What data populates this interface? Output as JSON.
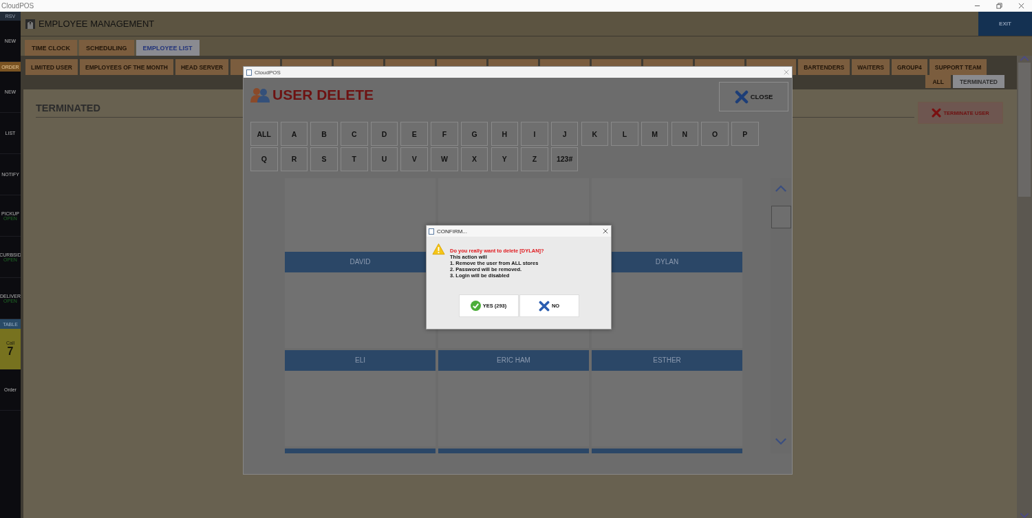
{
  "window": {
    "title": "CloudPOS"
  },
  "sidebar": [
    {
      "kind": "header",
      "label": "RSV"
    },
    {
      "kind": "item",
      "label": "NEW"
    },
    {
      "kind": "accent",
      "label": "ORDER"
    },
    {
      "kind": "item",
      "label": "NEW"
    },
    {
      "kind": "item",
      "label": "LIST"
    },
    {
      "kind": "item",
      "label": "NOTIFY"
    },
    {
      "kind": "status",
      "label": "PICKUP",
      "status": "OPEN"
    },
    {
      "kind": "status",
      "label": "CURBSID",
      "status": "OPEN"
    },
    {
      "kind": "status",
      "label": "DELIVER",
      "status": "OPEN"
    },
    {
      "kind": "section",
      "label": "TABLE"
    },
    {
      "kind": "highlight",
      "label": "Call",
      "value": "7"
    },
    {
      "kind": "item",
      "label": "Order"
    }
  ],
  "header": {
    "title": "EMPLOYEE MANAGEMENT",
    "exit": "EXIT"
  },
  "tabs": [
    {
      "label": "TIME CLOCK",
      "selected": false
    },
    {
      "label": "SCHEDULING",
      "selected": false
    },
    {
      "label": "EMPLOYEE LIST",
      "selected": true
    }
  ],
  "groups": [
    {
      "kind": "tab",
      "label": "LIMITED USER"
    },
    {
      "kind": "tab",
      "label": "EMPLOYEES OF THE MONTH"
    },
    {
      "kind": "tab",
      "label": "HEAD SERVER"
    },
    {
      "kind": "covered"
    },
    {
      "kind": "covered"
    },
    {
      "kind": "covered"
    },
    {
      "kind": "covered"
    },
    {
      "kind": "covered"
    },
    {
      "kind": "covered"
    },
    {
      "kind": "covered"
    },
    {
      "kind": "covered"
    },
    {
      "kind": "covered"
    },
    {
      "kind": "covered"
    },
    {
      "kind": "covered"
    },
    {
      "kind": "tab",
      "label": "BARTENDERS"
    },
    {
      "kind": "tab",
      "label": "WAITERS"
    },
    {
      "kind": "tab",
      "label": "GROUP4"
    },
    {
      "kind": "tab",
      "label": "SUPPORT TEAM"
    }
  ],
  "filters": [
    {
      "label": "ALL",
      "selected": false
    },
    {
      "label": "TERMINATED",
      "selected": true
    }
  ],
  "section_title": "TERMINATED",
  "terminate_button": "TERMINATE USER",
  "dialog": {
    "title": "CloudPOS",
    "heading": "USER DELETE",
    "close": "CLOSE",
    "letters": [
      "ALL",
      "A",
      "B",
      "C",
      "D",
      "E",
      "F",
      "G",
      "H",
      "I",
      "J",
      "K",
      "L",
      "M",
      "N",
      "O",
      "P",
      "Q",
      "R",
      "S",
      "T",
      "U",
      "V",
      "W",
      "X",
      "Y",
      "Z",
      "123#"
    ],
    "employees": [
      {
        "kind": "named",
        "name": "DAVID"
      },
      {
        "kind": "covered"
      },
      {
        "kind": "named",
        "name": "DYLAN"
      },
      {
        "kind": "named",
        "name": "ELI"
      },
      {
        "kind": "named",
        "name": "ERIC HAM"
      },
      {
        "kind": "named",
        "name": "ESTHER"
      }
    ]
  },
  "confirm": {
    "title": "CONFIRM...",
    "question": "Do you really want to delete [DYLAN]?",
    "lines": [
      "This action will",
      "1. Remove the user from ALL stores",
      "2. Password will be removed.",
      "3. Login will be disabled"
    ],
    "yes": "YES (293)",
    "no": "NO"
  }
}
